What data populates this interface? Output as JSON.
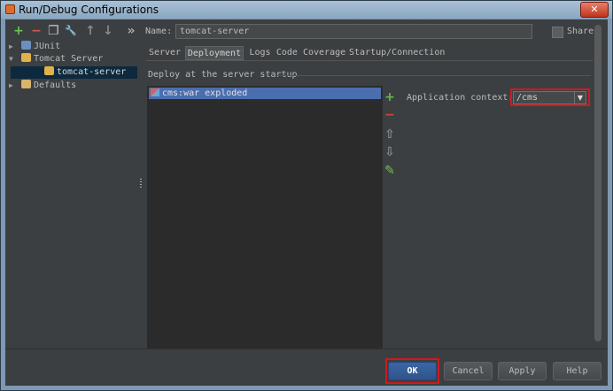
{
  "window": {
    "title": "Run/Debug Configurations",
    "close_glyph": "✕"
  },
  "toolbar": {
    "icons": [
      {
        "name": "add-icon",
        "glyph": "+",
        "color": "#6ac44b"
      },
      {
        "name": "remove-icon",
        "glyph": "−",
        "color": "#d45b45"
      },
      {
        "name": "copy-icon",
        "glyph": "❐",
        "color": "#c8c8c8"
      },
      {
        "name": "wrench-icon",
        "glyph": "🔧",
        "color": "#d7b56d"
      },
      {
        "name": "up-arrow-icon",
        "glyph": "↑",
        "color": "#8a8a8a"
      },
      {
        "name": "down-arrow-icon",
        "glyph": "↓",
        "color": "#8a8a8a"
      },
      {
        "name": "expand-icon",
        "glyph": "»",
        "color": "#aaaaaa"
      }
    ]
  },
  "tree": {
    "items": [
      {
        "label": "JUnit",
        "expanded": false,
        "level": 0
      },
      {
        "label": "Tomcat Server",
        "expanded": true,
        "level": 0
      },
      {
        "label": "tomcat-server",
        "level": 1,
        "selected": true
      },
      {
        "label": "Defaults",
        "expanded": false,
        "level": 0
      }
    ]
  },
  "name": {
    "label": "Name:",
    "value": "tomcat-server"
  },
  "share": {
    "label": "Share",
    "checked": false
  },
  "tabs": [
    "Server",
    "Deployment",
    "Logs",
    "Code Coverage",
    "Startup/Connection"
  ],
  "active_tab": "Deployment",
  "deploy": {
    "section_title": "Deploy at the server startup",
    "items": [
      "cms:war exploded"
    ],
    "side_icons": [
      {
        "name": "add-icon",
        "glyph": "+",
        "color": "#5fbf4a"
      },
      {
        "name": "remove-icon",
        "glyph": "−",
        "color": "#d0463c"
      },
      {
        "name": "move-up-icon",
        "glyph": "⇧",
        "color": "#8a8a8a"
      },
      {
        "name": "move-down-icon",
        "glyph": "⇩",
        "color": "#8a8a8a"
      },
      {
        "name": "edit-icon",
        "glyph": "✎",
        "color": "#6ac44b"
      }
    ]
  },
  "context": {
    "label": "Application context:",
    "value": "/cms"
  },
  "buttons": {
    "ok": "OK",
    "cancel": "Cancel",
    "apply": "Apply",
    "help": "Help"
  },
  "colors": {
    "highlight": "#d0191d",
    "selection": "#4b6eaf",
    "background": "#3c3f41"
  }
}
